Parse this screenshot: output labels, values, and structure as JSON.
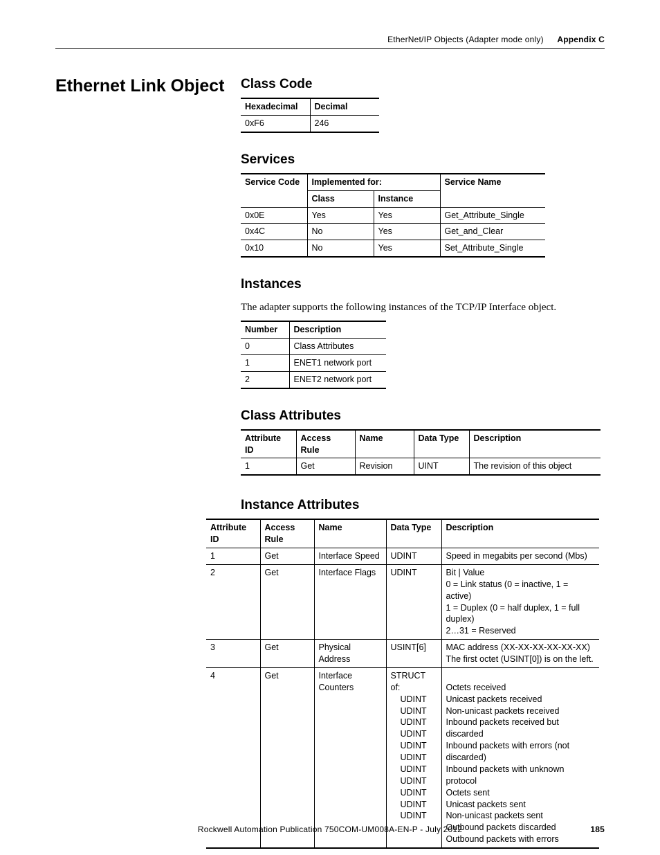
{
  "header": {
    "context": "EtherNet/IP Objects (Adapter mode only)",
    "appendix": "Appendix C"
  },
  "left_title": "Ethernet Link Object",
  "class_code": {
    "heading": "Class Code",
    "headers": [
      "Hexadecimal",
      "Decimal"
    ],
    "row": [
      "0xF6",
      "246"
    ]
  },
  "services": {
    "heading": "Services",
    "h_code": "Service Code",
    "h_impl": "Implemented for:",
    "h_class": "Class",
    "h_instance": "Instance",
    "h_name": "Service Name",
    "rows": [
      {
        "code": "0x0E",
        "cls": "Yes",
        "inst": "Yes",
        "name": "Get_Attribute_Single"
      },
      {
        "code": "0x4C",
        "cls": "No",
        "inst": "Yes",
        "name": "Get_and_Clear"
      },
      {
        "code": "0x10",
        "cls": "No",
        "inst": "Yes",
        "name": "Set_Attribute_Single"
      }
    ]
  },
  "instances": {
    "heading": "Instances",
    "intro": "The adapter supports the following instances of the TCP/IP Interface object.",
    "headers": [
      "Number",
      "Description"
    ],
    "rows": [
      {
        "n": "0",
        "d": "Class Attributes"
      },
      {
        "n": "1",
        "d": "ENET1 network port"
      },
      {
        "n": "2",
        "d": "ENET2 network port"
      }
    ]
  },
  "class_attrs": {
    "heading": "Class Attributes",
    "headers": [
      "Attribute ID",
      "Access Rule",
      "Name",
      "Data Type",
      "Description"
    ],
    "row": {
      "id": "1",
      "rule": "Get",
      "name": "Revision",
      "dtype": "UINT",
      "desc": "The revision of this object"
    }
  },
  "inst_attrs": {
    "heading": "Instance Attributes",
    "headers": [
      "Attribute ID",
      "Access Rule",
      "Name",
      "Data Type",
      "Description"
    ],
    "rows": [
      {
        "id": "1",
        "rule": "Get",
        "name": "Interface Speed",
        "dtype": "UDINT",
        "desc": "Speed in megabits per second (Mbs)"
      },
      {
        "id": "2",
        "rule": "Get",
        "name": "Interface Flags",
        "dtype": "UDINT",
        "desc_lines": [
          "Bit | Value",
          "0 = Link status (0 = inactive, 1 = active)",
          "1 = Duplex (0 = half duplex, 1 = full duplex)",
          "2…31 = Reserved"
        ]
      },
      {
        "id": "3",
        "rule": "Get",
        "name": "Physical Address",
        "dtype": "USINT[6]",
        "desc_lines": [
          "MAC address (XX-XX-XX-XX-XX-XX)",
          "The first octet (USINT[0]) is on the left."
        ]
      },
      {
        "id": "4",
        "rule": "Get",
        "name": "Interface Counters",
        "dtype_lines": [
          "STRUCT of:",
          "UDINT",
          "UDINT",
          "UDINT",
          "UDINT",
          "UDINT",
          "UDINT",
          "UDINT",
          "UDINT",
          "UDINT",
          "UDINT",
          "UDINT"
        ],
        "desc_lines": [
          "",
          "Octets received",
          "Unicast packets received",
          "Non-unicast packets received",
          "Inbound packets received but discarded",
          "Inbound packets with errors (not discarded)",
          "Inbound packets with unknown protocol",
          "Octets sent",
          "Unicast packets sent",
          "Non-unicast packets sent",
          "Outbound packets discarded",
          "Outbound packets with errors"
        ]
      }
    ]
  },
  "footer": {
    "pub": "Rockwell Automation Publication 750COM-UM008A-EN-P - July 2012",
    "page": "185"
  }
}
